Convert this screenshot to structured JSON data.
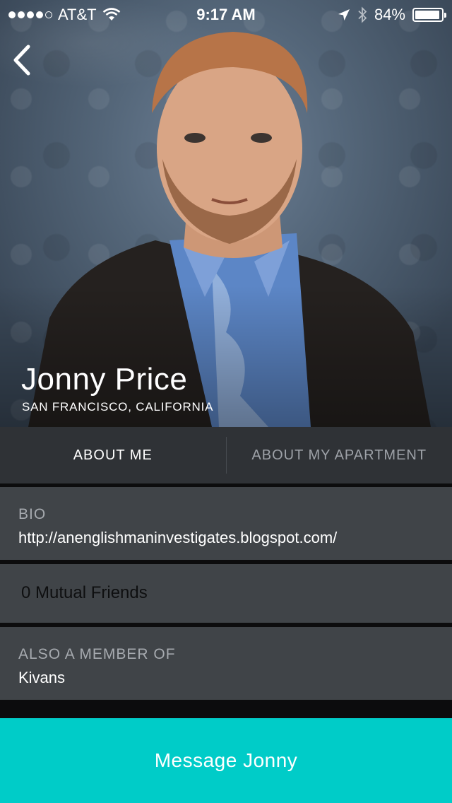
{
  "status_bar": {
    "carrier": "AT&T",
    "time": "9:17 AM",
    "battery": "84%",
    "signal_dots_filled": 4,
    "signal_dots_total": 5,
    "icons": [
      "signal-dots-icon",
      "wifi-icon",
      "location-arrow-icon",
      "bluetooth-icon",
      "battery-icon"
    ]
  },
  "profile": {
    "name": "Jonny Price",
    "location": "SAN FRANCISCO, CALIFORNIA"
  },
  "tabs": [
    {
      "label": "ABOUT ME",
      "active": true
    },
    {
      "label": "ABOUT MY APARTMENT",
      "active": false
    }
  ],
  "bio": {
    "label": "BIO",
    "value": "http://anenglishmaninvestigates.blogspot.com/"
  },
  "mutual_friends": {
    "text": "0 Mutual Friends"
  },
  "membership": {
    "label": "ALSO A MEMBER OF",
    "value": "Kivans"
  },
  "message_button": {
    "label": "Message Jonny"
  },
  "colors": {
    "accent": "#00ccc8",
    "tab_bar": "#2f3236",
    "card": "#404448",
    "background": "#0c0c0d"
  }
}
